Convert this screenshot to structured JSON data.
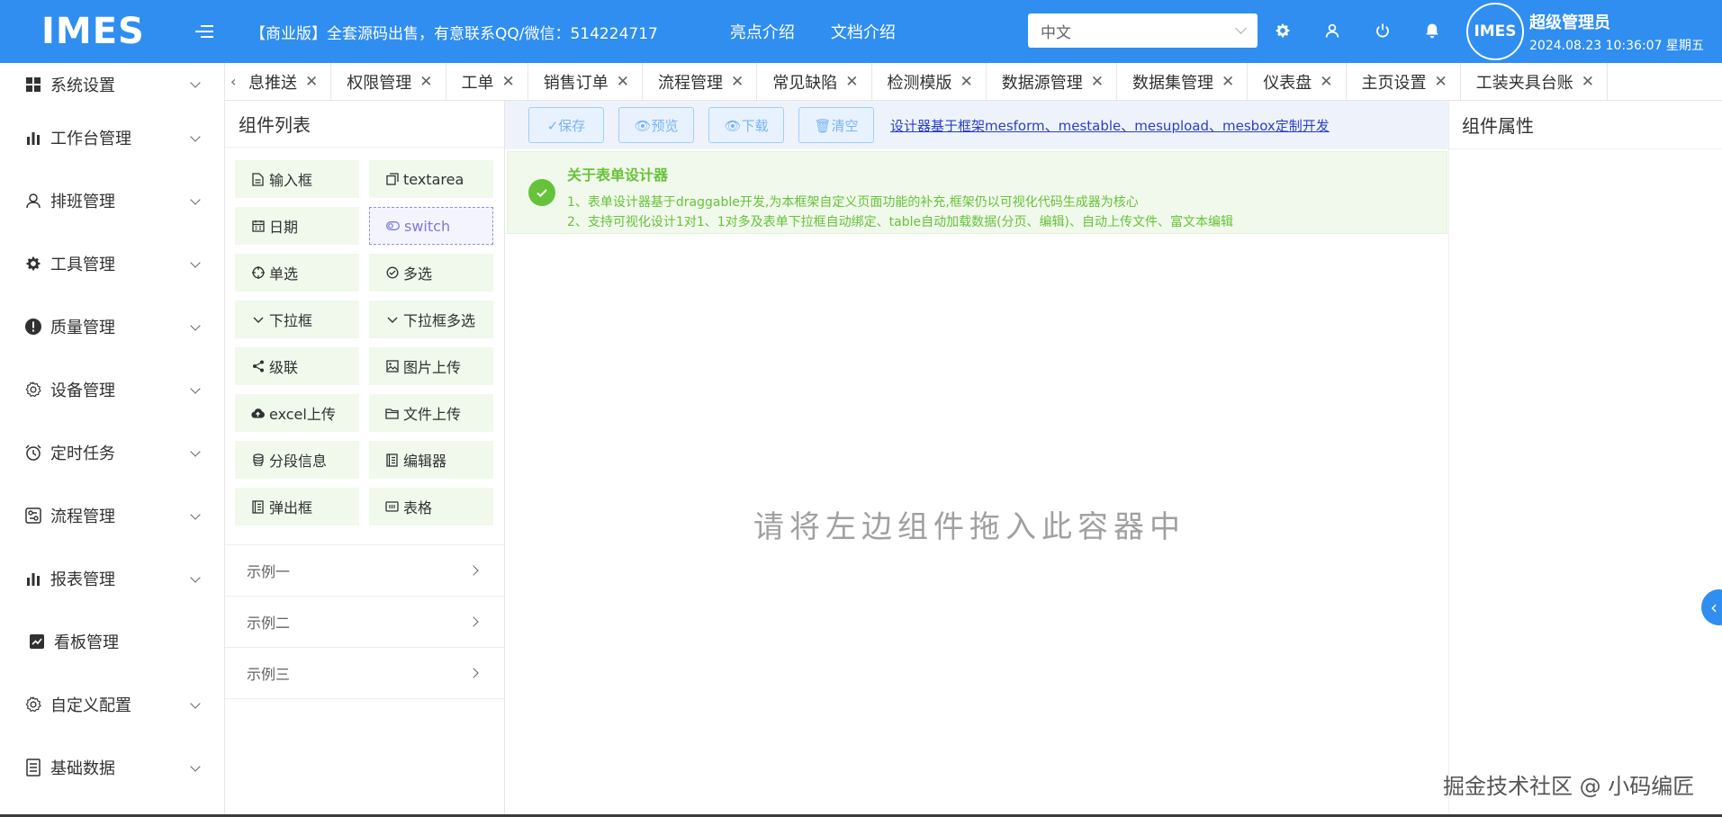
{
  "header": {
    "logo": "IMES",
    "notice": "【商业版】全套源码出售，有意联系QQ/微信：514224717",
    "nav": [
      "亮点介绍",
      "文档介绍"
    ],
    "language": "中文",
    "user": {
      "avatar_text": "IMES",
      "name": "超级管理员",
      "datetime": "2024.08.23 10:36:07 星期五"
    },
    "icons": [
      "gear-icon",
      "user-icon",
      "power-icon",
      "bell-icon"
    ]
  },
  "sidebar": {
    "items": [
      {
        "label": "系统设置",
        "icon": "grid-icon"
      },
      {
        "label": "工作台管理",
        "icon": "bar-chart-icon"
      },
      {
        "label": "排班管理",
        "icon": "person-icon"
      },
      {
        "label": "工具管理",
        "icon": "gear-icon"
      },
      {
        "label": "质量管理",
        "icon": "warning-icon"
      },
      {
        "label": "设备管理",
        "icon": "settings-icon"
      },
      {
        "label": "定时任务",
        "icon": "alarm-icon"
      },
      {
        "label": "流程管理",
        "icon": "flow-icon"
      },
      {
        "label": "报表管理",
        "icon": "bar-chart-icon"
      },
      {
        "label": "看板管理",
        "icon": "trend-icon"
      },
      {
        "label": "自定义配置",
        "icon": "settings-icon"
      },
      {
        "label": "基础数据",
        "icon": "document-icon"
      }
    ]
  },
  "tabs": [
    "息推送",
    "权限管理",
    "工单",
    "销售订单",
    "流程管理",
    "常见缺陷",
    "检测模版",
    "数据源管理",
    "数据集管理",
    "仪表盘",
    "主页设置",
    "工装夹具台账"
  ],
  "components": {
    "title": "组件列表",
    "items": [
      {
        "label": "输入框",
        "icon": "doc-icon"
      },
      {
        "label": "textarea",
        "icon": "copy-icon"
      },
      {
        "label": "日期",
        "icon": "calendar-icon"
      },
      {
        "label": "switch",
        "icon": "toggle-icon"
      },
      {
        "label": "单选",
        "icon": "target-icon"
      },
      {
        "label": "多选",
        "icon": "check-circle-icon"
      },
      {
        "label": "下拉框",
        "icon": "chevron-down-icon"
      },
      {
        "label": "下拉框多选",
        "icon": "chevron-down-icon"
      },
      {
        "label": "级联",
        "icon": "share-icon"
      },
      {
        "label": "图片上传",
        "icon": "image-icon"
      },
      {
        "label": "excel上传",
        "icon": "cloud-upload-icon"
      },
      {
        "label": "文件上传",
        "icon": "folder-icon"
      },
      {
        "label": "分段信息",
        "icon": "coins-icon"
      },
      {
        "label": "编辑器",
        "icon": "notebook-icon"
      },
      {
        "label": "弹出框",
        "icon": "notebook-icon"
      },
      {
        "label": "表格",
        "icon": "table-icon"
      }
    ],
    "examples": [
      "示例一",
      "示例二",
      "示例三"
    ]
  },
  "designer": {
    "toolbar": {
      "save": "✓保存",
      "preview": "👁预览",
      "download": "👁下载",
      "clear": "🗑清空",
      "link": "设计器基于框架mesform、mestable、mesupload、mesbox定制开发"
    },
    "alert": {
      "title": "关于表单设计器",
      "line1": "1、表单设计器基于draggable开发,为本框架自定义页面功能的补充,框架仍以可视化代码生成器为核心",
      "line2": "2、支持可视化设计1对1、1对多及表单下拉框自动绑定、table自动加载数据(分页、编辑)、自动上传文件、富文本编辑"
    },
    "dropzone": "请将左边组件拖入此容器中"
  },
  "props": {
    "title": "组件属性"
  },
  "watermark": "掘金技术社区 @ 小码编匠",
  "colors": {
    "header": "#2f8ef0",
    "success": "#67c23a",
    "component_bg": "#f0f9eb",
    "link": "#2a3fc7"
  }
}
